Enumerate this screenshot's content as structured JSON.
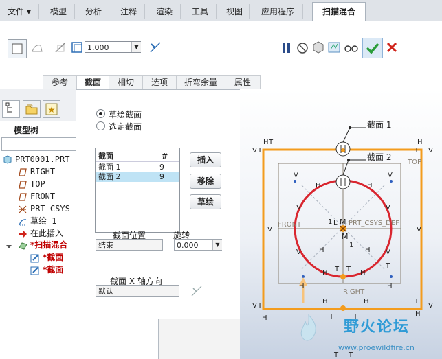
{
  "ribbon_tabs": [
    "文件 ▾",
    "模型",
    "分析",
    "注释",
    "渲染",
    "工具",
    "视图",
    "应用程序",
    "扫描混合"
  ],
  "ribbon": {
    "value": "1.000",
    "sub_tabs": [
      "参考",
      "截面",
      "相切",
      "选项",
      "折弯余量",
      "属性"
    ]
  },
  "left": {
    "tree_title": "模型树",
    "tree_items": [
      {
        "label": "PRT0001.PRT",
        "icon": "part-icon"
      },
      {
        "label": "RIGHT",
        "icon": "datum-plane-icon"
      },
      {
        "label": "TOP",
        "icon": "datum-plane-icon"
      },
      {
        "label": "FRONT",
        "icon": "datum-plane-icon"
      },
      {
        "label": "PRT_CSYS_",
        "icon": "csys-icon"
      },
      {
        "label": "草绘 1",
        "icon": "sketch-icon"
      },
      {
        "label": "在此插入",
        "icon": "insert-arrow-icon"
      },
      {
        "label": "*扫描混合",
        "icon": "sweep-blend-icon"
      },
      {
        "label": "*截面",
        "icon": "section-icon"
      },
      {
        "label": "*截面",
        "icon": "section-icon"
      }
    ]
  },
  "dialog": {
    "radio_sketch": "草绘截面",
    "radio_select": "选定截面",
    "table_header_name": "截面",
    "table_header_num": "#",
    "rows": [
      {
        "name": "截面 1",
        "num": "9"
      },
      {
        "name": "截面 2",
        "num": "9"
      }
    ],
    "insert_btn": "插入",
    "remove_btn": "移除",
    "sketch_btn": "草绘",
    "position_label": "截面位置",
    "position_value": "结束",
    "rotation_label": "旋转",
    "rotation_value": "0.000",
    "xaxis_label": "截面 X 轴方向",
    "xaxis_value": "默认"
  },
  "canvas": {
    "callout1": "截面 1",
    "callout2": "截面 2",
    "plane_top": "TOP",
    "plane_right": "RIGHT",
    "plane_front": "FRONT",
    "csys": "PRT_CSYS_DEF",
    "mark_v": "V",
    "mark_h": "H",
    "mark_t": "T",
    "mark_m": "M",
    "mark_l": "L",
    "mark_1": "1"
  },
  "watermark": {
    "cn": "野火论坛",
    "en": "www.proewildfire.cn"
  },
  "colors": {
    "accent_orange": "#f39c1e",
    "circle_red": "#d9262f",
    "confirm_green": "#2a9d3a",
    "cancel_red": "#d0241b",
    "selection_blue": "#bfe3f5"
  }
}
